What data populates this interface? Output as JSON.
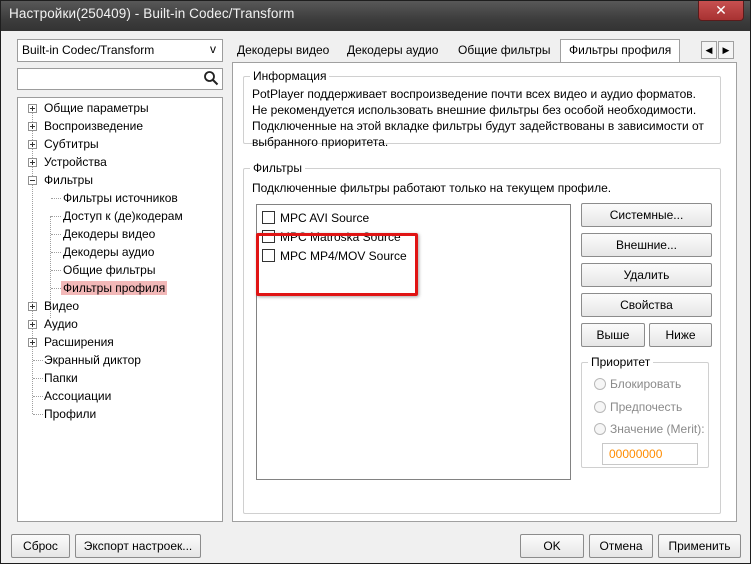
{
  "window": {
    "title": "Настройки(250409) - Built-in Codec/Transform",
    "close_glyph": "✕"
  },
  "left": {
    "combo_value": "Built-in Codec/Transform",
    "combo_arrow": "v",
    "search_placeholder": "",
    "tree": [
      {
        "label": "Общие параметры",
        "expander": "plus"
      },
      {
        "label": "Воспроизведение",
        "expander": "plus"
      },
      {
        "label": "Субтитры",
        "expander": "plus"
      },
      {
        "label": "Устройства",
        "expander": "plus"
      },
      {
        "label": "Фильтры",
        "expander": "minus"
      },
      {
        "label": "Фильтры источников",
        "expander": "none"
      },
      {
        "label": "Доступ к (де)кодерам",
        "expander": "none"
      },
      {
        "label": "Декодеры видео",
        "expander": "none"
      },
      {
        "label": "Декодеры аудио",
        "expander": "none"
      },
      {
        "label": "Общие фильтры",
        "expander": "none"
      },
      {
        "label": "Фильтры профиля",
        "expander": "none",
        "selected": true
      },
      {
        "label": "Видео",
        "expander": "plus"
      },
      {
        "label": "Аудио",
        "expander": "plus"
      },
      {
        "label": "Расширения",
        "expander": "plus"
      },
      {
        "label": "Экранный диктор",
        "expander": "none"
      },
      {
        "label": "Папки",
        "expander": "none"
      },
      {
        "label": "Ассоциации",
        "expander": "none"
      },
      {
        "label": "Профили",
        "expander": "none"
      }
    ]
  },
  "tabs": [
    {
      "label": "Декодеры видео"
    },
    {
      "label": "Декодеры аудио"
    },
    {
      "label": "Общие фильтры"
    },
    {
      "label": "Фильтры профиля",
      "active": true
    }
  ],
  "tab_scroll": {
    "left": "◀",
    "right": "▶"
  },
  "info": {
    "title": "Информация",
    "lines": [
      "PotPlayer поддерживает воспроизведение почти всех видео и аудио форматов.",
      "Не рекомендуется использовать внешние фильтры без особой необходимости.",
      "Подключенные на этой вкладке фильтры будут задействованы в зависимости от",
      "выбранного приоритета."
    ]
  },
  "filters": {
    "title": "Фильтры",
    "note": "Подключенные фильтры работают только на текущем профиле.",
    "items": [
      {
        "label": "MPC AVI Source",
        "checked": false
      },
      {
        "label": "MPC Matroska Source",
        "checked": false
      },
      {
        "label": "MPC MP4/MOV Source",
        "checked": false
      }
    ],
    "buttons": {
      "system": "Системные...",
      "external": "Внешние...",
      "delete": "Удалить",
      "properties": "Свойства",
      "up": "Выше",
      "down": "Ниже"
    },
    "priority": {
      "title": "Приоритет",
      "options": [
        "Блокировать",
        "Предпочесть",
        "Значение (Merit):"
      ],
      "merit_value": "00000000"
    }
  },
  "footer": {
    "reset": "Сброс",
    "export": "Экспорт настроек...",
    "ok": "OK",
    "cancel": "Отмена",
    "apply": "Применить"
  },
  "colors": {
    "selection": "#f2b8b8",
    "highlight_box": "#e01414",
    "merit_text": "#ff8c00",
    "titlebar": "#3d3d3d"
  }
}
